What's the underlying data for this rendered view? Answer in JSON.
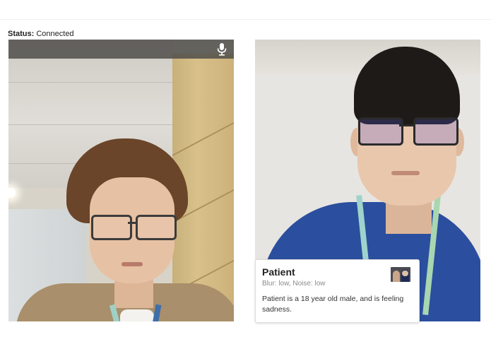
{
  "status": {
    "label": "Status:",
    "value": "Connected"
  },
  "local_video": {
    "mic_icon": "microphone-icon"
  },
  "remote_video": {
    "info_card": {
      "title": "Patient",
      "meta": "Blur: low, Noise: low",
      "description": "Patient is a 18 year old male, and is feeling sadness."
    }
  },
  "colors": {
    "overlay_bar": "#504e4a",
    "card_border": "#dedede",
    "meta_text": "#8a8a8a"
  }
}
